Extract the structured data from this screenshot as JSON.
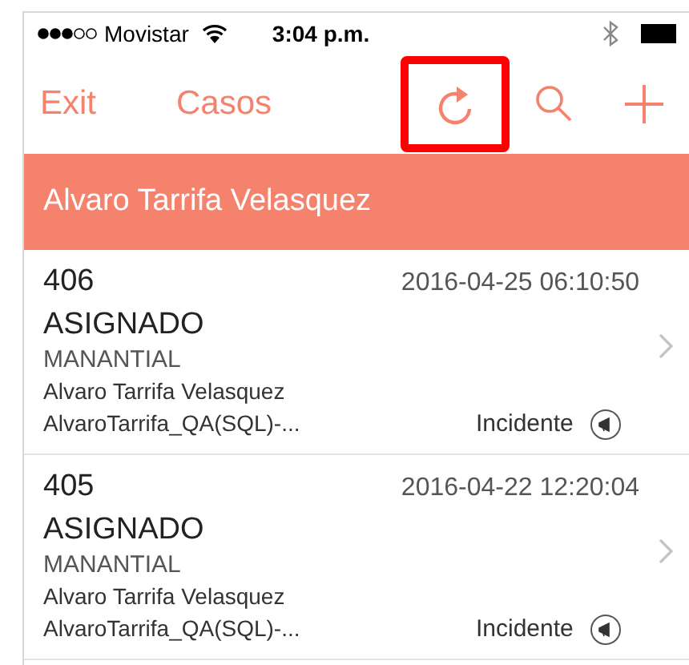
{
  "status_bar": {
    "carrier": "Movistar",
    "time": "3:04 p.m."
  },
  "nav": {
    "exit": "Exit",
    "title": "Casos",
    "actions": [
      {
        "kind": "refresh",
        "highlighted": true
      },
      {
        "kind": "search",
        "highlighted": false
      },
      {
        "kind": "add",
        "highlighted": false
      }
    ]
  },
  "header": {
    "title": "Alvaro Tarrifa Velasquez"
  },
  "cases": [
    {
      "number": "406",
      "date": "2016-04-25 06:10:50",
      "status": "ASIGNADO",
      "location": "MANANTIAL",
      "person": "Alvaro Tarrifa Velasquez",
      "user": "AlvaroTarrifa_QA(SQL)-...",
      "type": "Incidente"
    },
    {
      "number": "405",
      "date": "2016-04-22 12:20:04",
      "status": "ASIGNADO",
      "location": "MANANTIAL",
      "person": "Alvaro Tarrifa Velasquez",
      "user": "AlvaroTarrifa_QA(SQL)-...",
      "type": "Incidente"
    }
  ]
}
